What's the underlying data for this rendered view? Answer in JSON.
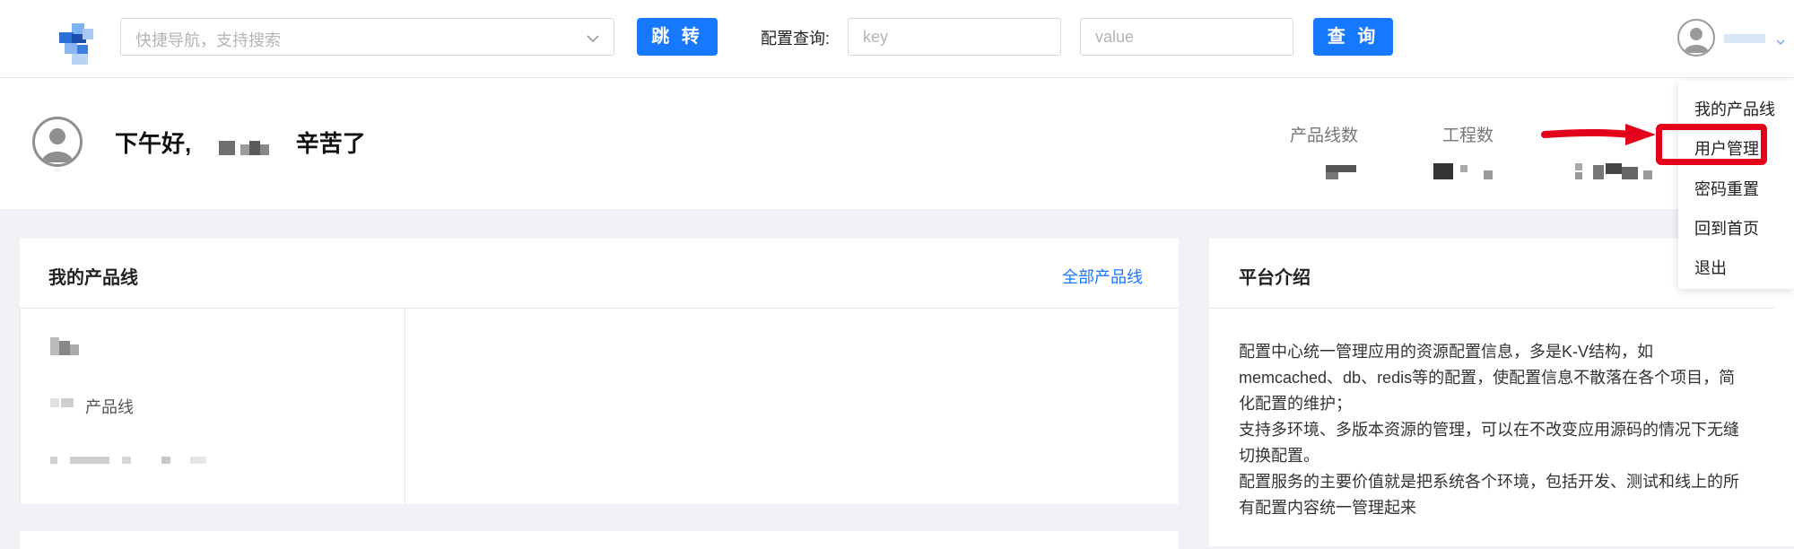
{
  "header": {
    "nav_placeholder": "快捷导航，支持搜索",
    "jump_label": "跳 转",
    "config_query_label": "配置查询:",
    "key_placeholder": "key",
    "value_placeholder": "value",
    "query_label": "查 询"
  },
  "greeting": {
    "prefix": "下午好,",
    "suffix": "辛苦了"
  },
  "stats": [
    {
      "label": "产品线数"
    },
    {
      "label": "工程数"
    }
  ],
  "product_lines": {
    "title": "我的产品线",
    "all_link": "全部产品线",
    "item_name_suffix": "产品线"
  },
  "platform_intro": {
    "title": "平台介绍",
    "paragraphs": [
      "配置中心统一管理应用的资源配置信息，多是K-V结构，如memcached、db、redis等的配置，使配置信息不散落在各个项目，简化配置的维护；",
      "支持多环境、多版本资源的管理，可以在不改变应用源码的情况下无缝切换配置。",
      "配置服务的主要价值就是把系统各个环境，包括开发、测试和线上的所有配置内容统一管理起来"
    ]
  },
  "user_menu": {
    "items": [
      "我的产品线",
      "用户管理",
      "密码重置",
      "回到首页",
      "退出"
    ],
    "highlighted": "用户管理"
  },
  "colors": {
    "primary": "#1677ff",
    "highlight": "#e4001b",
    "background": "#f0f2f5"
  }
}
